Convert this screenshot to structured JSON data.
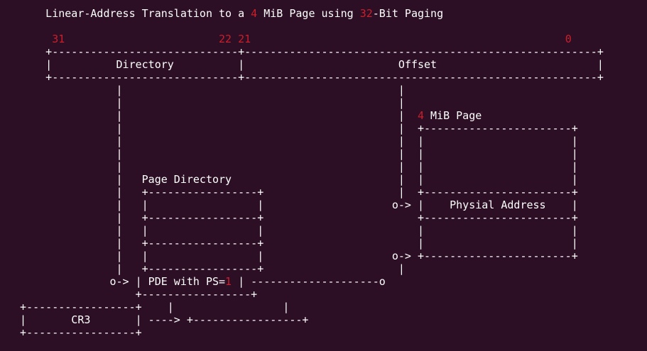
{
  "diagram": {
    "lines": [
      [
        {
          "t": "      Linear-Address Translation to a "
        },
        {
          "t": "4",
          "c": "num"
        },
        {
          "t": " MiB Page using "
        },
        {
          "t": "32",
          "c": "num"
        },
        {
          "t": "-Bit Paging"
        }
      ],
      [
        {
          "t": ""
        }
      ],
      [
        {
          "t": "       "
        },
        {
          "t": "31",
          "c": "num"
        },
        {
          "t": "                        "
        },
        {
          "t": "22",
          "c": "num"
        },
        {
          "t": " "
        },
        {
          "t": "21",
          "c": "num"
        },
        {
          "t": "                                                 "
        },
        {
          "t": "0",
          "c": "num"
        }
      ],
      [
        {
          "t": "      +-----------------------------+-------------------------------------------------------+"
        }
      ],
      [
        {
          "t": "      |          Directory          |                        Offset                         |"
        }
      ],
      [
        {
          "t": "      +-----------------------------+-------------------------------------------------------+"
        }
      ],
      [
        {
          "t": "                 |                                           |"
        }
      ],
      [
        {
          "t": "                 |                                           |"
        }
      ],
      [
        {
          "t": "                 |                                           |  "
        },
        {
          "t": "4",
          "c": "num"
        },
        {
          "t": " MiB Page"
        }
      ],
      [
        {
          "t": "                 |                                           |  +-----------------------+"
        }
      ],
      [
        {
          "t": "                 |                                           |  |                       |"
        }
      ],
      [
        {
          "t": "                 |                                           |  |                       |"
        }
      ],
      [
        {
          "t": "                 |                                           |  |                       |"
        }
      ],
      [
        {
          "t": "                 |   Page Directory                          |  |                       |"
        }
      ],
      [
        {
          "t": "                 |   +-----------------+                     |  +-----------------------+"
        }
      ],
      [
        {
          "t": "                 |   |                 |                    o-> |    Physial Address    |"
        }
      ],
      [
        {
          "t": "                 |   +-----------------+                        +-----------------------+"
        }
      ],
      [
        {
          "t": "                 |   |                 |                        |                       |"
        }
      ],
      [
        {
          "t": "                 |   +-----------------+                        |                       |"
        }
      ],
      [
        {
          "t": "                 |   |                 |                    o-> +-----------------------+"
        }
      ],
      [
        {
          "t": "                 |   +-----------------+                     |"
        }
      ],
      [
        {
          "t": "                o-> | PDE with PS="
        },
        {
          "t": "1",
          "c": "num"
        },
        {
          "t": " | --------------------o"
        }
      ],
      [
        {
          "t": "                    +-----------------+"
        }
      ],
      [
        {
          "t": "  +-----------------+    |                 |"
        }
      ],
      [
        {
          "t": "  |       CR3       | ----> +-----------------+"
        }
      ],
      [
        {
          "t": "  +-----------------+"
        }
      ]
    ]
  }
}
